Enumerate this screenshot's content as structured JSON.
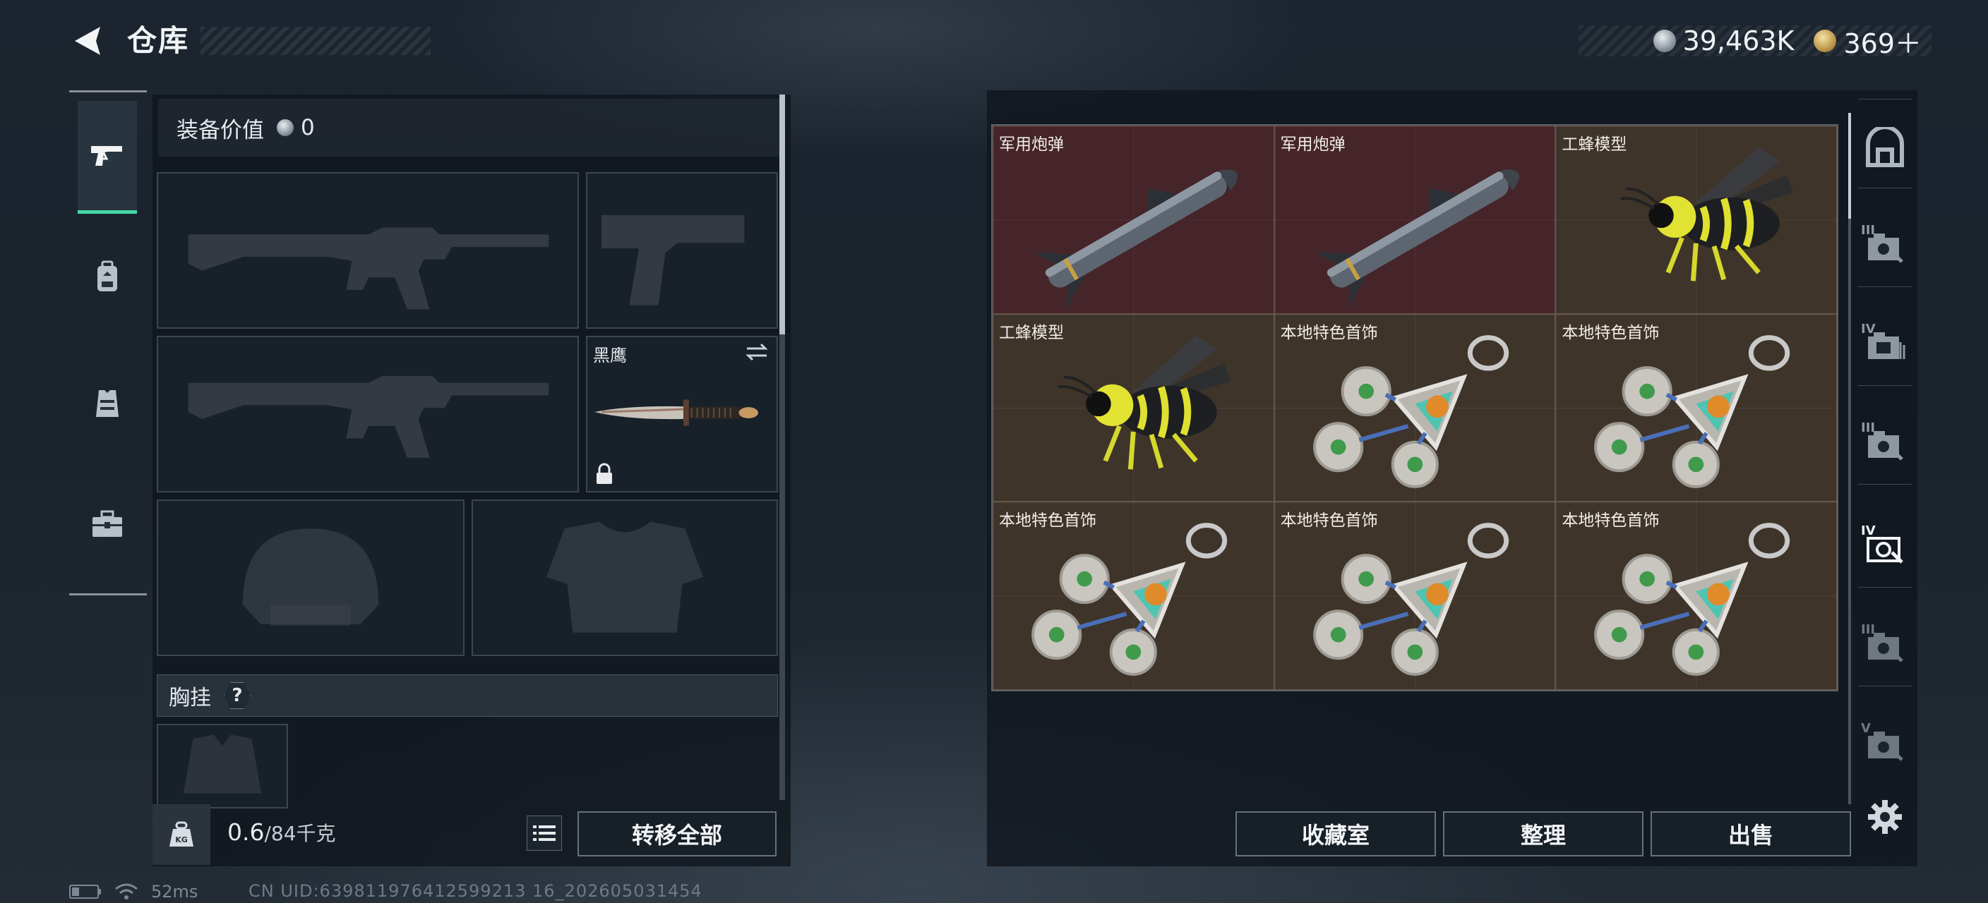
{
  "header": {
    "title": "仓库",
    "currencies": [
      {
        "name": "silver-coin",
        "value": "39,463K"
      },
      {
        "name": "gold-coin",
        "value": "369＋"
      }
    ]
  },
  "left_rail": {
    "tabs": [
      {
        "icon": "pistol-icon",
        "active": true
      },
      {
        "icon": "backpack-icon",
        "active": false
      },
      {
        "icon": "vest-icon",
        "active": false
      },
      {
        "icon": "toolbox-icon",
        "active": false
      }
    ]
  },
  "equipment": {
    "value_label": "装备价值",
    "value": "0",
    "melee_slot_name": "黑鹰",
    "chest_label": "胸挂",
    "chest_help": "?"
  },
  "carry": {
    "weight_current": "0.6",
    "weight_capacity": "/84千克",
    "transfer_all_label": "转移全部"
  },
  "storage": {
    "items": [
      {
        "name": "军用炮弹",
        "icon": "missile-icon",
        "rarity": "red"
      },
      {
        "name": "军用炮弹",
        "icon": "missile-icon",
        "rarity": "red"
      },
      {
        "name": "工蜂模型",
        "icon": "bee-model-icon",
        "rarity": "brown"
      },
      {
        "name": "工蜂模型",
        "icon": "bee-model-icon",
        "rarity": "brown"
      },
      {
        "name": "本地特色首饰",
        "icon": "jewelry-keychain-icon",
        "rarity": "brown"
      },
      {
        "name": "本地特色首饰",
        "icon": "jewelry-keychain-icon",
        "rarity": "brown"
      },
      {
        "name": "本地特色首饰",
        "icon": "jewelry-keychain-icon",
        "rarity": "brown"
      },
      {
        "name": "本地特色首饰",
        "icon": "jewelry-keychain-icon",
        "rarity": "brown"
      },
      {
        "name": "本地特色首饰",
        "icon": "jewelry-keychain-icon",
        "rarity": "brown"
      }
    ],
    "buttons": {
      "collection": "收藏室",
      "sort": "整理",
      "sell": "出售"
    }
  },
  "right_rail": {
    "tabs": [
      {
        "icon": "safe-room-icon",
        "label": ""
      },
      {
        "icon": "storage-tier-icon",
        "label": "III"
      },
      {
        "icon": "storage-tier-icon",
        "label": "IV"
      },
      {
        "icon": "storage-tier-icon",
        "label": "III"
      },
      {
        "icon": "storage-tier-icon",
        "label": "IV",
        "active": true
      },
      {
        "icon": "storage-tier-icon",
        "label": "III"
      },
      {
        "icon": "storage-tier-icon",
        "label": "V"
      }
    ],
    "settings_icon": "gear-icon"
  },
  "status": {
    "ping": "52ms",
    "uid": "CN UID:639811976412599213 16_202605031454"
  },
  "colors": {
    "accent": "#43d9a8",
    "rarity_red": "#45242a",
    "rarity_brown": "#3f342a"
  }
}
